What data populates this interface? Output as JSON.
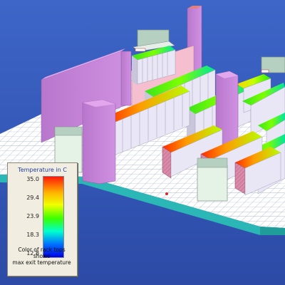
{
  "legend": {
    "title": "Temperature in C",
    "ticks": [
      "35.0",
      "29.4",
      "23.9",
      "18.3",
      "12.8"
    ],
    "caption": [
      "Color of rack tops",
      "shows",
      "max exit temperature"
    ]
  },
  "colors": {
    "background_top": "#3c63c4",
    "background_bottom": "#2f4fb1",
    "floor": "#ffffff",
    "floor_edge": "#2bb7b5",
    "wall": "#c883d8",
    "pink_panel": "#f6bfcf",
    "rack_body": "#e9e7f5",
    "hot_rack_face": "#d984a6",
    "crac_unit": "#e5f3e6"
  }
}
